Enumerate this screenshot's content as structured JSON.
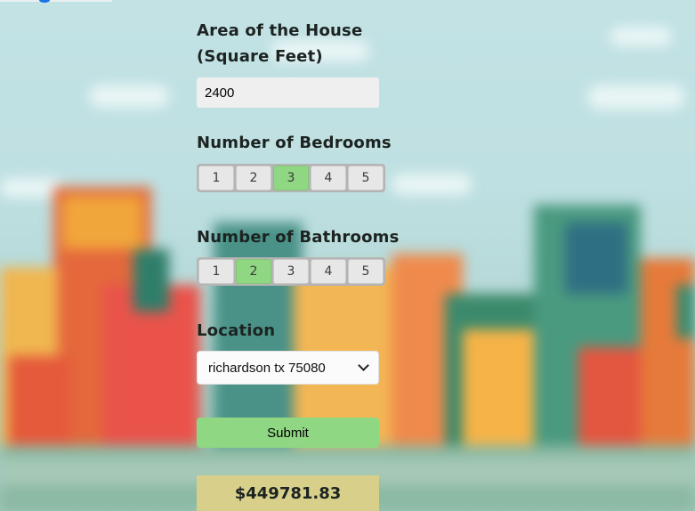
{
  "area": {
    "label": "Area of the House (Square Feet)",
    "value": "2400"
  },
  "bedrooms": {
    "label": "Number of Bedrooms",
    "options": [
      "1",
      "2",
      "3",
      "4",
      "5"
    ],
    "selected": "3"
  },
  "bathrooms": {
    "label": "Number of Bathrooms",
    "options": [
      "1",
      "2",
      "3",
      "4",
      "5"
    ],
    "selected": "2"
  },
  "location": {
    "label": "Location",
    "selected": "richardson tx 75080"
  },
  "submit_label": "Submit",
  "result": "$449781.83",
  "colors": {
    "accent_green": "#8fd782",
    "result_bg": "#d8d08a"
  }
}
